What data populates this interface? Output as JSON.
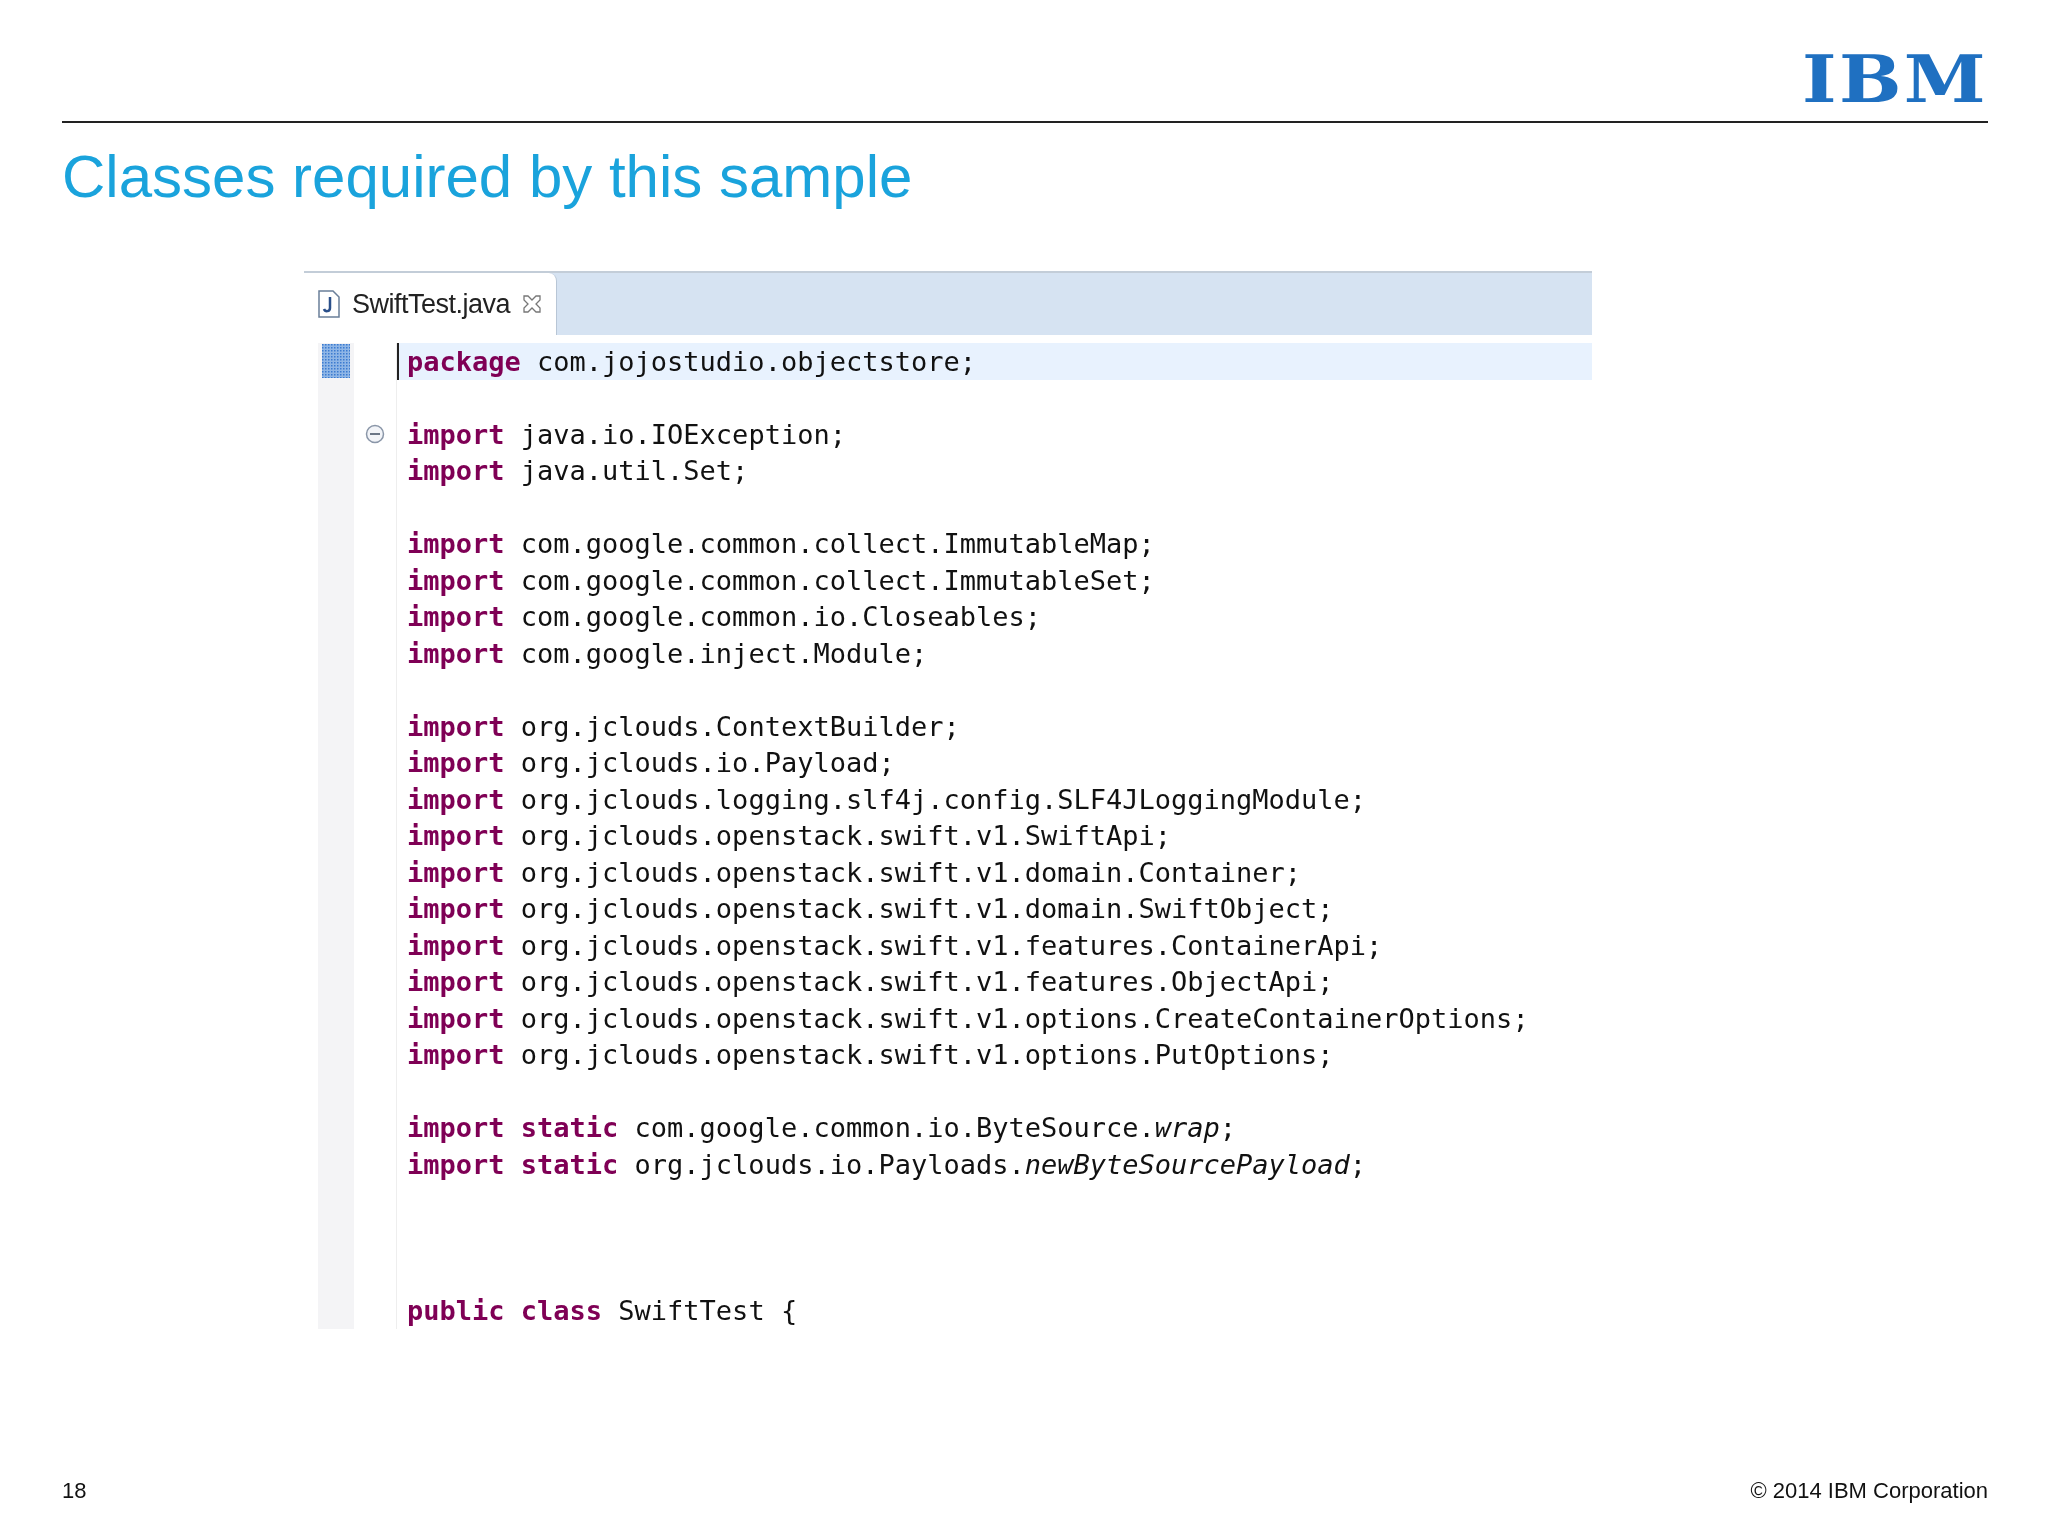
{
  "logo": "IBM",
  "title": "Classes required by this sample",
  "editor": {
    "tabs": [
      {
        "label": "SwiftTest.java",
        "selected": true
      }
    ],
    "lines": [
      {
        "kind": "code",
        "current": true,
        "fold": false,
        "tokens": [
          {
            "kind": "keyword",
            "text": "package"
          },
          {
            "kind": "plain",
            "text": " com.jojostudio.objectstore;"
          }
        ]
      },
      {
        "kind": "blank"
      },
      {
        "kind": "code",
        "current": false,
        "fold": true,
        "tokens": [
          {
            "kind": "keyword",
            "text": "import"
          },
          {
            "kind": "plain",
            "text": " java.io.IOException;"
          }
        ]
      },
      {
        "kind": "code",
        "current": false,
        "fold": false,
        "tokens": [
          {
            "kind": "keyword",
            "text": "import"
          },
          {
            "kind": "plain",
            "text": " java.util.Set;"
          }
        ]
      },
      {
        "kind": "blank"
      },
      {
        "kind": "code",
        "current": false,
        "fold": false,
        "tokens": [
          {
            "kind": "keyword",
            "text": "import"
          },
          {
            "kind": "plain",
            "text": " com.google.common.collect.ImmutableMap;"
          }
        ]
      },
      {
        "kind": "code",
        "current": false,
        "fold": false,
        "tokens": [
          {
            "kind": "keyword",
            "text": "import"
          },
          {
            "kind": "plain",
            "text": " com.google.common.collect.ImmutableSet;"
          }
        ]
      },
      {
        "kind": "code",
        "current": false,
        "fold": false,
        "tokens": [
          {
            "kind": "keyword",
            "text": "import"
          },
          {
            "kind": "plain",
            "text": " com.google.common.io.Closeables;"
          }
        ]
      },
      {
        "kind": "code",
        "current": false,
        "fold": false,
        "tokens": [
          {
            "kind": "keyword",
            "text": "import"
          },
          {
            "kind": "plain",
            "text": " com.google.inject.Module;"
          }
        ]
      },
      {
        "kind": "blank"
      },
      {
        "kind": "code",
        "current": false,
        "fold": false,
        "tokens": [
          {
            "kind": "keyword",
            "text": "import"
          },
          {
            "kind": "plain",
            "text": " org.jclouds.ContextBuilder;"
          }
        ]
      },
      {
        "kind": "code",
        "current": false,
        "fold": false,
        "tokens": [
          {
            "kind": "keyword",
            "text": "import"
          },
          {
            "kind": "plain",
            "text": " org.jclouds.io.Payload;"
          }
        ]
      },
      {
        "kind": "code",
        "current": false,
        "fold": false,
        "tokens": [
          {
            "kind": "keyword",
            "text": "import"
          },
          {
            "kind": "plain",
            "text": " org.jclouds.logging.slf4j.config.SLF4JLoggingModule;"
          }
        ]
      },
      {
        "kind": "code",
        "current": false,
        "fold": false,
        "tokens": [
          {
            "kind": "keyword",
            "text": "import"
          },
          {
            "kind": "plain",
            "text": " org.jclouds.openstack.swift.v1.SwiftApi;"
          }
        ]
      },
      {
        "kind": "code",
        "current": false,
        "fold": false,
        "tokens": [
          {
            "kind": "keyword",
            "text": "import"
          },
          {
            "kind": "plain",
            "text": " org.jclouds.openstack.swift.v1.domain.Container;"
          }
        ]
      },
      {
        "kind": "code",
        "current": false,
        "fold": false,
        "tokens": [
          {
            "kind": "keyword",
            "text": "import"
          },
          {
            "kind": "plain",
            "text": " org.jclouds.openstack.swift.v1.domain.SwiftObject;"
          }
        ]
      },
      {
        "kind": "code",
        "current": false,
        "fold": false,
        "tokens": [
          {
            "kind": "keyword",
            "text": "import"
          },
          {
            "kind": "plain",
            "text": " org.jclouds.openstack.swift.v1.features.ContainerApi;"
          }
        ]
      },
      {
        "kind": "code",
        "current": false,
        "fold": false,
        "tokens": [
          {
            "kind": "keyword",
            "text": "import"
          },
          {
            "kind": "plain",
            "text": " org.jclouds.openstack.swift.v1.features.ObjectApi;"
          }
        ]
      },
      {
        "kind": "code",
        "current": false,
        "fold": false,
        "tokens": [
          {
            "kind": "keyword",
            "text": "import"
          },
          {
            "kind": "plain",
            "text": " org.jclouds.openstack.swift.v1.options.CreateContainerOptions;"
          }
        ]
      },
      {
        "kind": "code",
        "current": false,
        "fold": false,
        "tokens": [
          {
            "kind": "keyword",
            "text": "import"
          },
          {
            "kind": "plain",
            "text": " org.jclouds.openstack.swift.v1.options.PutOptions;"
          }
        ]
      },
      {
        "kind": "blank"
      },
      {
        "kind": "code",
        "current": false,
        "fold": false,
        "tokens": [
          {
            "kind": "keyword",
            "text": "import static"
          },
          {
            "kind": "plain",
            "text": " com.google.common.io.ByteSource."
          },
          {
            "kind": "static",
            "text": "wrap"
          },
          {
            "kind": "plain",
            "text": ";"
          }
        ]
      },
      {
        "kind": "code",
        "current": false,
        "fold": false,
        "tokens": [
          {
            "kind": "keyword",
            "text": "import static"
          },
          {
            "kind": "plain",
            "text": " org.jclouds.io.Payloads."
          },
          {
            "kind": "static",
            "text": "newByteSourcePayload"
          },
          {
            "kind": "plain",
            "text": ";"
          }
        ]
      },
      {
        "kind": "blank"
      },
      {
        "kind": "blank"
      },
      {
        "kind": "blank"
      },
      {
        "kind": "code",
        "current": false,
        "fold": false,
        "tokens": [
          {
            "kind": "keyword",
            "text": "public class"
          },
          {
            "kind": "plain",
            "text": " SwiftTest {"
          }
        ]
      }
    ]
  },
  "page_number": "18",
  "copyright": "© 2014 IBM Corporation"
}
